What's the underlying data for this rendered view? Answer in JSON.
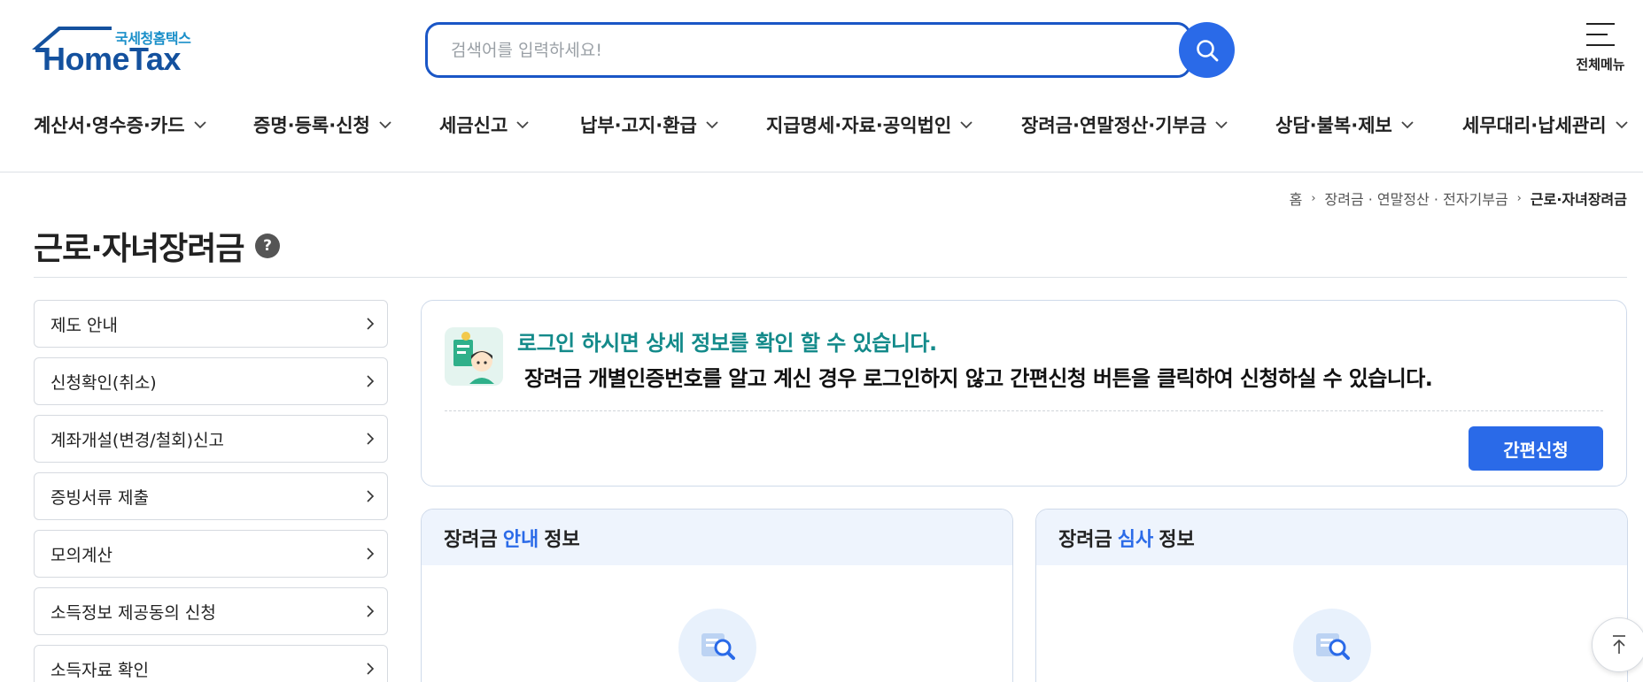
{
  "header": {
    "logo_sub": "국세청홈택스",
    "logo_main": "HomeTax",
    "search_placeholder": "검색어를 입력하세요!",
    "all_menu_label": "전체메뉴"
  },
  "gnb": [
    {
      "label": "계산서·영수증·카드"
    },
    {
      "label": "증명·등록·신청"
    },
    {
      "label": "세금신고"
    },
    {
      "label": "납부·고지·환급"
    },
    {
      "label": "지급명세·자료·공익법인"
    },
    {
      "label": "장려금·연말정산·기부금"
    },
    {
      "label": "상담·불복·제보"
    },
    {
      "label": "세무대리·납세관리"
    }
  ],
  "breadcrumb": {
    "home": "홈",
    "parent": "장려금 · 연말정산 · 전자기부금",
    "current": "근로·자녀장려금"
  },
  "page": {
    "title": "근로·자녀장려금",
    "help": "?"
  },
  "side_menu": [
    {
      "label": "제도 안내"
    },
    {
      "label": "신청확인(취소)"
    },
    {
      "label": "계좌개설(변경/철회)신고"
    },
    {
      "label": "증빙서류 제출"
    },
    {
      "label": "모의계산"
    },
    {
      "label": "소득정보 제공동의 신청"
    },
    {
      "label": "소득자료 확인"
    }
  ],
  "notice": {
    "title": "로그인 하시면 상세 정보를 확인 할 수 있습니다.",
    "text": "장려금 개별인증번호를 알고 계신 경우 로그인하지 않고 간편신청 버튼을 클릭하여 신청하실 수 있습니다.",
    "button": "간편신청"
  },
  "cards": [
    {
      "pre": "장려금",
      "highlight": "안내",
      "post": "정보"
    },
    {
      "pre": "장려금",
      "highlight": "심사",
      "post": "정보"
    }
  ],
  "colors": {
    "primary": "#2a6ae8",
    "logo_blue": "#14519e",
    "notice_title": "#138a8a",
    "card_head_bg": "#eef4fd"
  },
  "icons": {
    "search": "search-icon",
    "menu": "hamburger-icon",
    "chevron": "chevron-down-icon",
    "arrow": "chevron-right-icon",
    "top": "arrow-up-icon"
  }
}
